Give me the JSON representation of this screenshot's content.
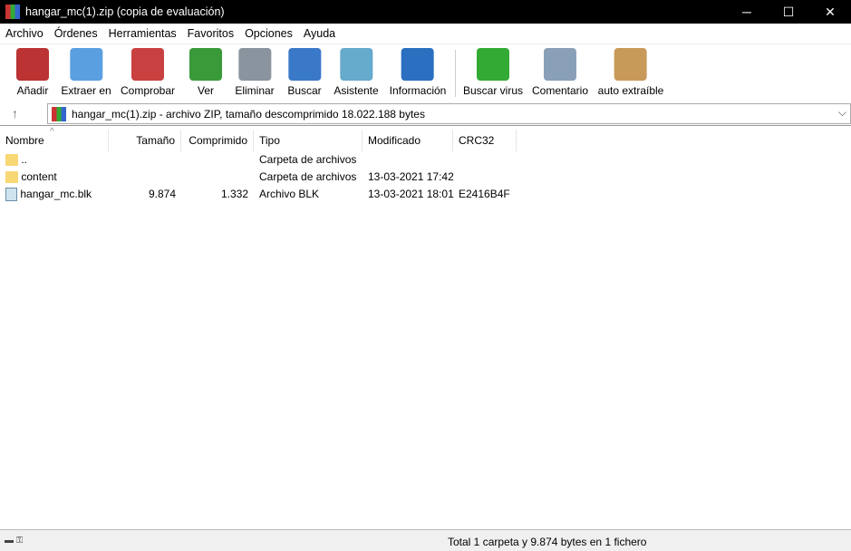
{
  "window": {
    "title": "hangar_mc(1).zip (copia de evaluación)",
    "minimize": "─",
    "maximize": "☐",
    "close": "✕"
  },
  "menu": [
    "Archivo",
    "Órdenes",
    "Herramientas",
    "Favoritos",
    "Opciones",
    "Ayuda"
  ],
  "toolbar": [
    {
      "label": "Añadir",
      "icon": "add-archive-icon",
      "color": "#b33"
    },
    {
      "label": "Extraer en",
      "icon": "extract-folder-icon",
      "color": "#5aa0e0"
    },
    {
      "label": "Comprobar",
      "icon": "test-clipboard-icon",
      "color": "#c94040"
    },
    {
      "label": "Ver",
      "icon": "view-book-icon",
      "color": "#3a9a3a"
    },
    {
      "label": "Eliminar",
      "icon": "trash-icon",
      "color": "#8a949e"
    },
    {
      "label": "Buscar",
      "icon": "search-icon",
      "color": "#3a78c8"
    },
    {
      "label": "Asistente",
      "icon": "wizard-icon",
      "color": "#6ac"
    },
    {
      "label": "Información",
      "icon": "info-icon",
      "color": "#2a6fc0"
    },
    {
      "label": "Buscar virus",
      "icon": "virus-scan-icon",
      "color": "#3a3"
    },
    {
      "label": "Comentario",
      "icon": "comment-icon",
      "color": "#8aa0b8"
    },
    {
      "label": "auto extraíble",
      "icon": "sfx-box-icon",
      "color": "#c89a5a"
    }
  ],
  "address": {
    "up": "↑",
    "path": "hangar_mc(1).zip - archivo ZIP, tamaño descomprimido 18.022.188 bytes",
    "chevron": "⌵"
  },
  "columns": [
    "Nombre",
    "Tamaño",
    "Comprimido",
    "Tipo",
    "Modificado",
    "CRC32"
  ],
  "sort_indicator": "^",
  "rows": [
    {
      "name": "..",
      "size": "",
      "packed": "",
      "type": "Carpeta de archivos",
      "modified": "",
      "crc": "",
      "kind": "folder"
    },
    {
      "name": "content",
      "size": "",
      "packed": "",
      "type": "Carpeta de archivos",
      "modified": "13-03-2021 17:42",
      "crc": "",
      "kind": "folder"
    },
    {
      "name": "hangar_mc.blk",
      "size": "9.874",
      "packed": "1.332",
      "type": "Archivo BLK",
      "modified": "13-03-2021 18:01",
      "crc": "E2416B4F",
      "kind": "file"
    }
  ],
  "status": {
    "text": "Total 1 carpeta y 9.874 bytes en 1 fichero"
  }
}
